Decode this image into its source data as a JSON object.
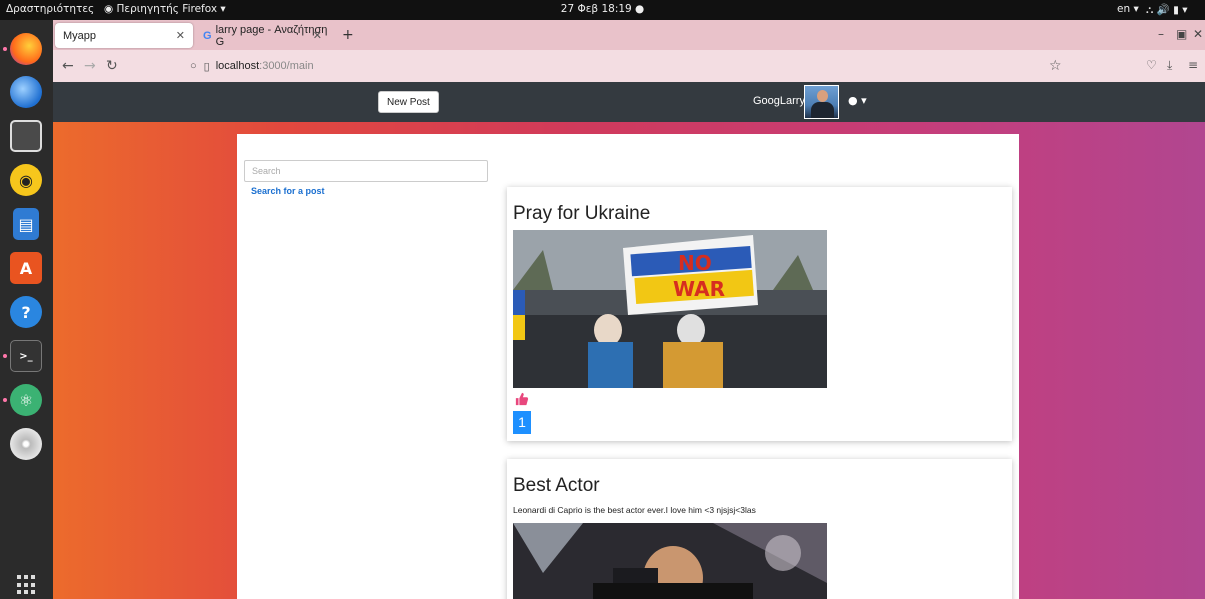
{
  "system": {
    "activities": "Δραστηριότητες",
    "app_menu": "Περιηγητής Firefox",
    "clock": "27 Φεβ 18:19",
    "language": "en"
  },
  "dock": {
    "apps": [
      "firefox-icon",
      "thunderbird-icon",
      "files-icon",
      "rhythmbox-icon",
      "writer-icon",
      "software-icon",
      "help-icon",
      "terminal-icon",
      "atom-icon",
      "disc-icon"
    ]
  },
  "browser": {
    "tabs": [
      {
        "label": "Myapp"
      },
      {
        "label": "larry page - Αναζήτηση G",
        "favicon": "G"
      }
    ],
    "url_host": "localhost",
    "url_path": ":3000/main"
  },
  "header": {
    "new_post_label": "New Post",
    "username": "GoogLarry"
  },
  "sidebar": {
    "search_placeholder": "Search",
    "search_link": "Search for a post"
  },
  "posts": [
    {
      "title": "Pray for Ukraine",
      "likes": "1",
      "image_sign_line1": "NO",
      "image_sign_line2": "WAR"
    },
    {
      "title": "Best Actor",
      "body": "Leonardi di Caprio is the best actor ever.I love him <3 njsjsj<3las"
    }
  ],
  "colors": {
    "header_bg": "#343a40",
    "like_blue": "#1e90ff",
    "like_pink": "#e8477d",
    "link_blue": "#1a6fd0",
    "tabstrip": "#e9c2ca"
  }
}
